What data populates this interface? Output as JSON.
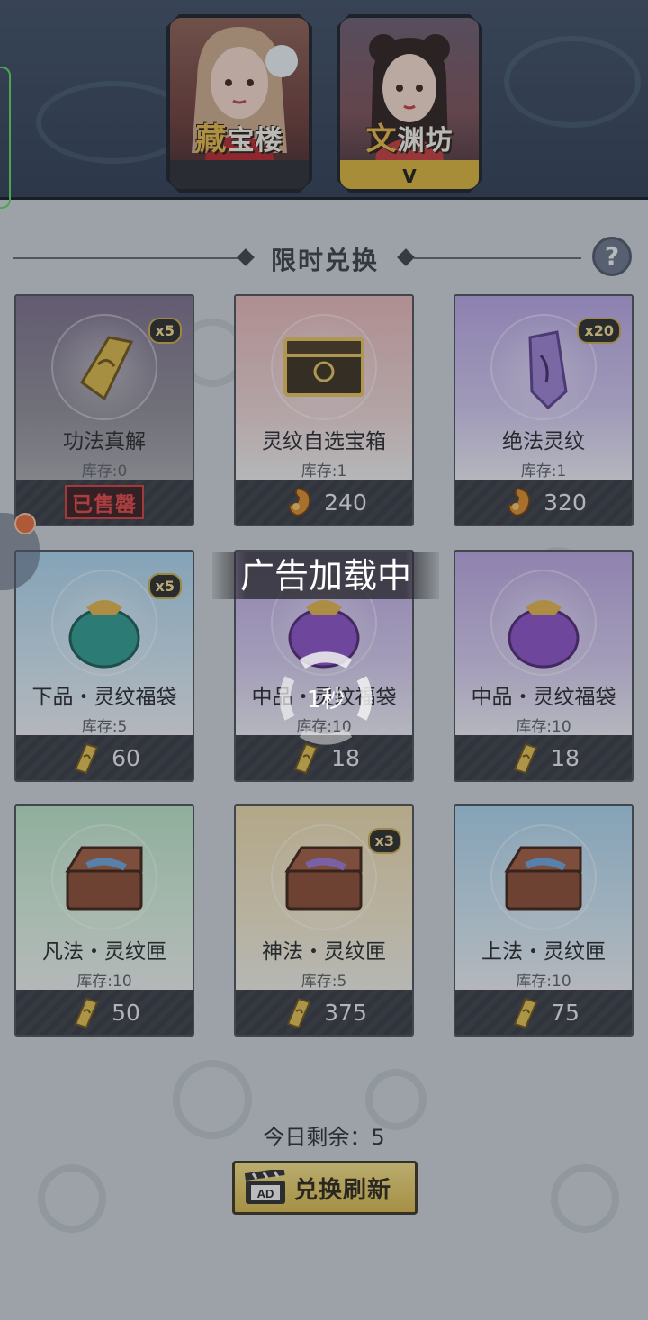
{
  "tabs": [
    {
      "first_char": "藏",
      "rest": "宝楼"
    },
    {
      "first_char": "文",
      "rest": "渊坊",
      "selected_mark": "V"
    }
  ],
  "section": {
    "title": "限时兑换",
    "help": "?"
  },
  "items": [
    {
      "name": "功法真解",
      "stock": "库存:0",
      "qty": "x5",
      "price": "",
      "sold_out": "已售罄",
      "currency": "scroll"
    },
    {
      "name": "灵纹自选宝箱",
      "stock": "库存:1",
      "qty": "",
      "price": "240",
      "sold_out": "",
      "currency": "coin"
    },
    {
      "name": "绝法灵纹",
      "stock": "库存:1",
      "qty": "x20",
      "price": "320",
      "sold_out": "",
      "currency": "coin"
    },
    {
      "name": "下品・灵纹福袋",
      "stock": "库存:5",
      "qty": "x5",
      "price": "60",
      "sold_out": "",
      "currency": "scroll"
    },
    {
      "name": "中品・灵纹福袋",
      "stock": "库存:10",
      "qty": "",
      "price": "18",
      "sold_out": "",
      "currency": "scroll"
    },
    {
      "name": "中品・灵纹福袋",
      "stock": "库存:10",
      "qty": "",
      "price": "18",
      "sold_out": "",
      "currency": "scroll"
    },
    {
      "name": "凡法・灵纹匣",
      "stock": "库存:10",
      "qty": "",
      "price": "50",
      "sold_out": "",
      "currency": "scroll"
    },
    {
      "name": "神法・灵纹匣",
      "stock": "库存:5",
      "qty": "x3",
      "price": "375",
      "sold_out": "",
      "currency": "scroll"
    },
    {
      "name": "上法・灵纹匣",
      "stock": "库存:10",
      "qty": "",
      "price": "75",
      "sold_out": "",
      "currency": "scroll"
    }
  ],
  "loading": {
    "title": "广告加载中",
    "countdown": "1秒"
  },
  "footer": {
    "remaining": "今日剩余：5",
    "refresh_label": "兑换刷新",
    "ad_badge": "AD"
  },
  "colors": {
    "accent_gold": "#d7b64b",
    "sold_out_red": "#e04444",
    "header_bg": "#2f3c52"
  }
}
